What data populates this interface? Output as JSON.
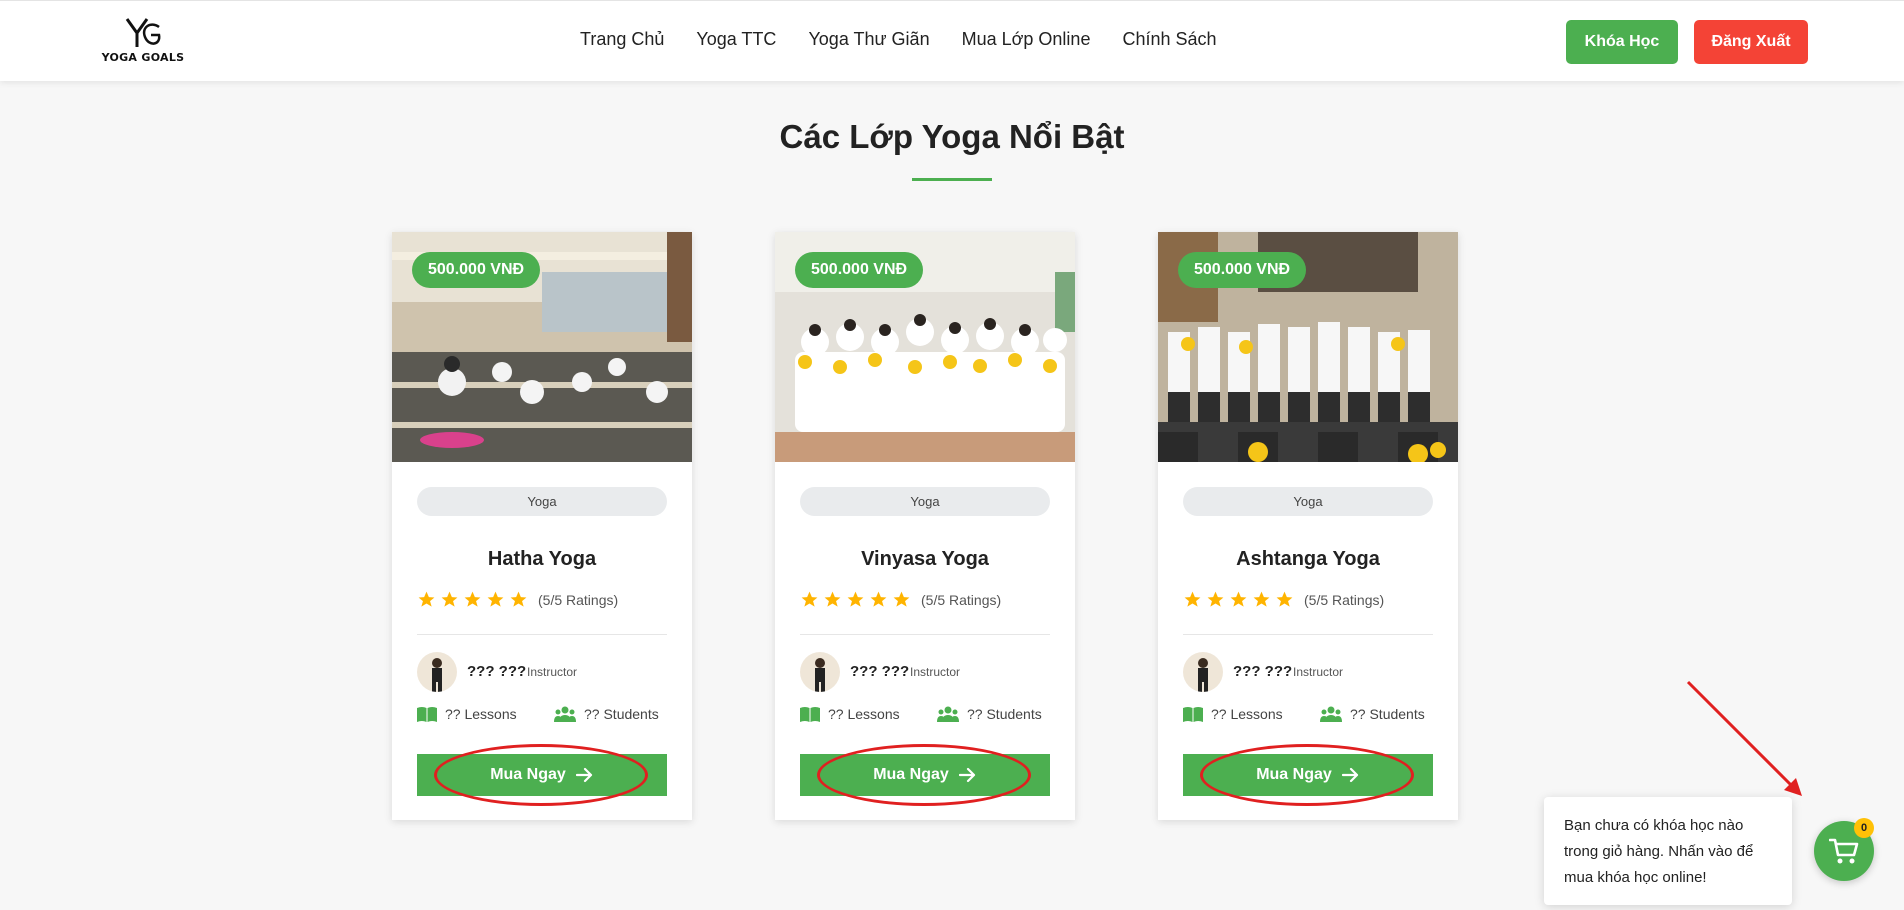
{
  "header": {
    "logo_text": "YOGA GOALS",
    "nav": [
      "Trang Chủ",
      "Yoga TTC",
      "Yoga Thư Giãn",
      "Mua Lớp Online",
      "Chính Sách"
    ],
    "course_button": "Khóa Học",
    "logout_button": "Đăng Xuất"
  },
  "section": {
    "title": "Các Lớp Yoga Nổi Bật"
  },
  "cards": [
    {
      "price": "500.000 VNĐ",
      "tag": "Yoga",
      "title": "Hatha Yoga",
      "rating": 5,
      "rating_text": "(5/5 Ratings)",
      "instructor_name": "??? ???",
      "instructor_role": "Instructor",
      "lessons": "?? Lessons",
      "students": "?? Students",
      "buy_label": "Mua Ngay"
    },
    {
      "price": "500.000 VNĐ",
      "tag": "Yoga",
      "title": "Vinyasa Yoga",
      "rating": 5,
      "rating_text": "(5/5 Ratings)",
      "instructor_name": "??? ???",
      "instructor_role": "Instructor",
      "lessons": "?? Lessons",
      "students": "?? Students",
      "buy_label": "Mua Ngay"
    },
    {
      "price": "500.000 VNĐ",
      "tag": "Yoga",
      "title": "Ashtanga Yoga",
      "rating": 5,
      "rating_text": "(5/5 Ratings)",
      "instructor_name": "??? ???",
      "instructor_role": "Instructor",
      "lessons": "?? Lessons",
      "students": "?? Students",
      "buy_label": "Mua Ngay"
    }
  ],
  "cart": {
    "tooltip": "Bạn chưa có khóa học nào trong giỏ hàng. Nhấn vào để mua khóa học online!",
    "count": "0"
  },
  "icons": {
    "star": "star-icon",
    "lessons": "book-icon",
    "students": "users-icon",
    "buy": "arrow-right-icon",
    "cart": "cart-icon"
  },
  "colors": {
    "primary": "#4caf50",
    "danger": "#f44336",
    "star": "#ffb400",
    "annotation": "#e02020",
    "badge": "#ffc107"
  }
}
